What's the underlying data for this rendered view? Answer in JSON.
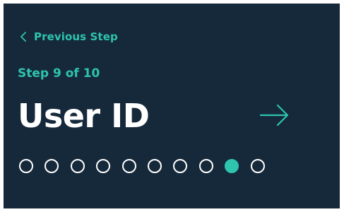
{
  "nav": {
    "previous_label": "Previous Step",
    "previous_icon": "chevron-left-icon",
    "next_icon": "arrow-right-icon"
  },
  "progress": {
    "step_text": "Step 9 of 10",
    "current_step": 9,
    "total_steps": 10
  },
  "page": {
    "title": "User ID"
  },
  "colors": {
    "background": "#16293b",
    "accent": "#2ec4ae",
    "text": "#ffffff"
  }
}
